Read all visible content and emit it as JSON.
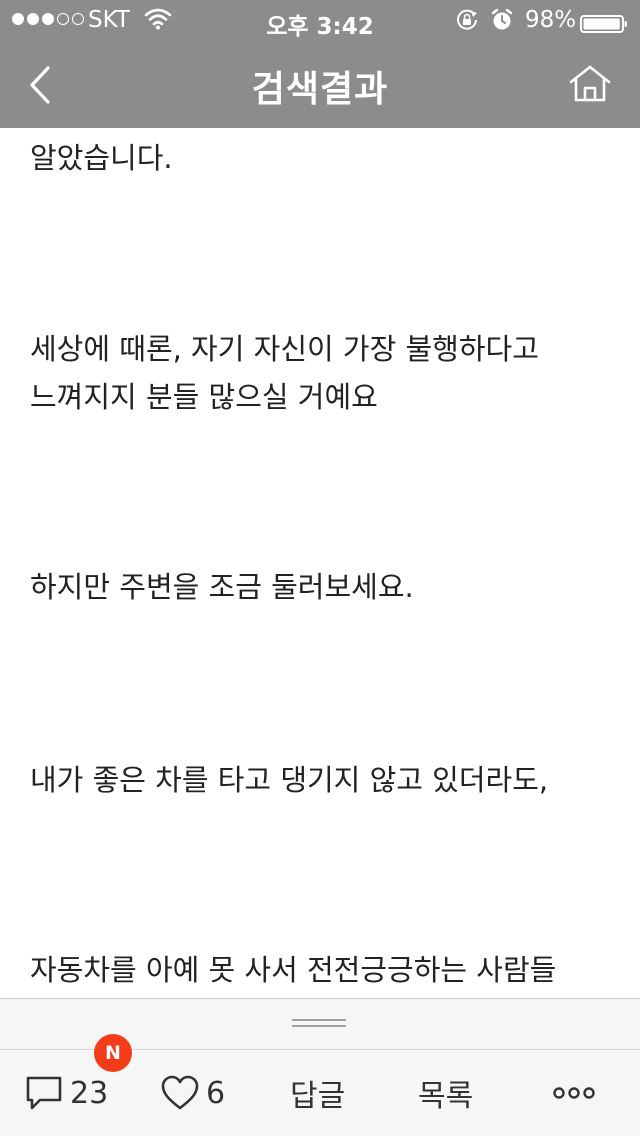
{
  "status_bar": {
    "carrier": "SKT",
    "time": "오후 3:42",
    "battery_percent": "98%",
    "signal_bars_filled": 3,
    "signal_bars_total": 5,
    "battery_level": 0.98,
    "icons": [
      "wifi-icon",
      "lock-rotation-icon",
      "alarm-icon",
      "battery-icon"
    ]
  },
  "nav": {
    "title": "검색결과",
    "back_icon": "chevron-left-icon",
    "home_icon": "home-icon"
  },
  "article": {
    "paragraphs": [
      "알았습니다.",
      "세상에 때론, 자기 자신이 가장 불행하다고",
      "느껴지지 분들 많으실 거예요",
      "하지만 주변을 조금 둘러보세요.",
      "내가 좋은 차를 타고 댕기지 않고 있더라도,",
      "자동차를 아예 못 사서 전전긍긍하는 사람들"
    ]
  },
  "toolbar": {
    "comment_count": "23",
    "new_badge": "N",
    "like_count": "6",
    "reply_label": "답글",
    "list_label": "목록",
    "colors": {
      "header_bg": "#8c8c8c",
      "badge_bg": "#f23d18",
      "toolbar_bg": "#f6f6f6"
    }
  }
}
